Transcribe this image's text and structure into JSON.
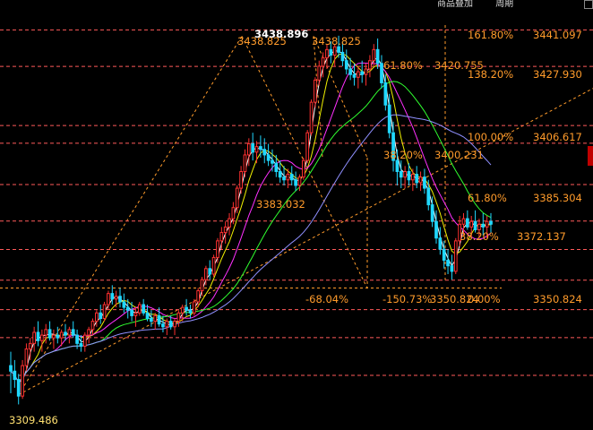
{
  "toolbar": {
    "items": [
      "商品叠加",
      "周期"
    ],
    "colors": {
      "text": "#d8d8d8"
    }
  },
  "chart_data": {
    "type": "candlestick",
    "title": "",
    "xlabel": "",
    "ylabel": "",
    "ylim": [
      3300,
      3448
    ],
    "grid": false,
    "colors": {
      "up": "#ff3030",
      "down": "#20d8ff",
      "fib_line": "#ff5a5a",
      "fib_text": "#ff9b2b",
      "helper": "#ff9b2b",
      "price_text": "#ffe070",
      "ma_white": "#ffffff",
      "ma_yellow": "#f0f000",
      "ma_magenta": "#ff30ff",
      "ma_green": "#30ff30",
      "ma_purple": "#9090ff"
    },
    "price_points": [
      {
        "name": "low-start",
        "price": 3309.486,
        "label": "3309.486"
      },
      {
        "name": "high-left",
        "price": 3438.825,
        "label": "3438.825"
      },
      {
        "name": "peak",
        "price": 3438.896,
        "label": "3438.896"
      },
      {
        "name": "high-right",
        "price": 3438.825,
        "label": "3438.825"
      },
      {
        "name": "mid-low",
        "price": 3383.032,
        "label": "3383.032"
      },
      {
        "name": "recent-low",
        "price": 3350.824,
        "label": "3350.824"
      }
    ],
    "fib_levels": [
      {
        "ratio": "161.80%",
        "price": 3441.097
      },
      {
        "ratio": "61.80%",
        "price": 3420.755
      },
      {
        "ratio": "138.20%",
        "price": 3427.93
      },
      {
        "ratio": "100.00%",
        "price": 3406.617
      },
      {
        "ratio": "38.20%",
        "price": 3400.231
      },
      {
        "ratio": "61.80%",
        "price": 3385.304
      },
      {
        "ratio": "38.20%",
        "price": 3372.137
      },
      {
        "ratio": "0.00%",
        "price": 3350.824
      }
    ],
    "fib_extra_labels": [
      "-68.04%",
      "-150.73%"
    ],
    "candles": [
      [
        3320,
        3325,
        3310,
        3318
      ],
      [
        3318,
        3322,
        3312,
        3315
      ],
      [
        3315,
        3317,
        3306,
        3309
      ],
      [
        3309,
        3322,
        3308,
        3320
      ],
      [
        3320,
        3328,
        3318,
        3326
      ],
      [
        3326,
        3330,
        3322,
        3328
      ],
      [
        3328,
        3334,
        3325,
        3332
      ],
      [
        3332,
        3336,
        3327,
        3329
      ],
      [
        3329,
        3333,
        3325,
        3331
      ],
      [
        3331,
        3335,
        3328,
        3333
      ],
      [
        3333,
        3336,
        3329,
        3330
      ],
      [
        3330,
        3333,
        3326,
        3331
      ],
      [
        3331,
        3334,
        3328,
        3330
      ],
      [
        3330,
        3333,
        3327,
        3332
      ],
      [
        3332,
        3335,
        3329,
        3331
      ],
      [
        3331,
        3334,
        3328,
        3333
      ],
      [
        3333,
        3336,
        3330,
        3331
      ],
      [
        3331,
        3333,
        3326,
        3328
      ],
      [
        3328,
        3331,
        3325,
        3327
      ],
      [
        3327,
        3332,
        3325,
        3331
      ],
      [
        3331,
        3334,
        3328,
        3333
      ],
      [
        3333,
        3337,
        3331,
        3336
      ],
      [
        3336,
        3340,
        3334,
        3339
      ],
      [
        3339,
        3342,
        3335,
        3337
      ],
      [
        3337,
        3343,
        3336,
        3342
      ],
      [
        3342,
        3347,
        3340,
        3346
      ],
      [
        3346,
        3349,
        3342,
        3344
      ],
      [
        3344,
        3347,
        3341,
        3345
      ],
      [
        3345,
        3348,
        3341,
        3343
      ],
      [
        3343,
        3346,
        3339,
        3341
      ],
      [
        3341,
        3344,
        3337,
        3340
      ],
      [
        3340,
        3343,
        3336,
        3338
      ],
      [
        3338,
        3341,
        3334,
        3339
      ],
      [
        3339,
        3343,
        3338,
        3342
      ],
      [
        3342,
        3344,
        3338,
        3339
      ],
      [
        3339,
        3342,
        3336,
        3337
      ],
      [
        3337,
        3340,
        3334,
        3336
      ],
      [
        3336,
        3339,
        3333,
        3338
      ],
      [
        3338,
        3341,
        3334,
        3335
      ],
      [
        3335,
        3338,
        3332,
        3334
      ],
      [
        3334,
        3337,
        3331,
        3336
      ],
      [
        3336,
        3338,
        3333,
        3334
      ],
      [
        3334,
        3337,
        3331,
        3336
      ],
      [
        3336,
        3340,
        3334,
        3339
      ],
      [
        3339,
        3342,
        3336,
        3341
      ],
      [
        3341,
        3344,
        3338,
        3340
      ],
      [
        3340,
        3342,
        3337,
        3339
      ],
      [
        3339,
        3344,
        3338,
        3343
      ],
      [
        3343,
        3348,
        3341,
        3347
      ],
      [
        3347,
        3352,
        3345,
        3351
      ],
      [
        3351,
        3356,
        3349,
        3355
      ],
      [
        3355,
        3358,
        3351,
        3353
      ],
      [
        3353,
        3360,
        3352,
        3359
      ],
      [
        3359,
        3366,
        3357,
        3365
      ],
      [
        3365,
        3370,
        3362,
        3368
      ],
      [
        3368,
        3372,
        3364,
        3370
      ],
      [
        3370,
        3375,
        3367,
        3373
      ],
      [
        3373,
        3379,
        3371,
        3377
      ],
      [
        3377,
        3385,
        3375,
        3384
      ],
      [
        3384,
        3392,
        3382,
        3390
      ],
      [
        3390,
        3398,
        3388,
        3396
      ],
      [
        3396,
        3402,
        3392,
        3400
      ],
      [
        3400,
        3404,
        3394,
        3397
      ],
      [
        3397,
        3401,
        3393,
        3399
      ],
      [
        3399,
        3403,
        3395,
        3398
      ],
      [
        3398,
        3402,
        3393,
        3396
      ],
      [
        3396,
        3400,
        3392,
        3394
      ],
      [
        3394,
        3398,
        3390,
        3393
      ],
      [
        3393,
        3396,
        3388,
        3390
      ],
      [
        3390,
        3394,
        3386,
        3388
      ],
      [
        3388,
        3392,
        3385,
        3387
      ],
      [
        3387,
        3391,
        3384,
        3389
      ],
      [
        3389,
        3392,
        3385,
        3387
      ],
      [
        3387,
        3390,
        3383,
        3385
      ],
      [
        3385,
        3389,
        3383,
        3388
      ],
      [
        3388,
        3395,
        3387,
        3394
      ],
      [
        3394,
        3405,
        3393,
        3404
      ],
      [
        3404,
        3416,
        3403,
        3415
      ],
      [
        3415,
        3424,
        3413,
        3423
      ],
      [
        3423,
        3430,
        3421,
        3428
      ],
      [
        3428,
        3433,
        3424,
        3431
      ],
      [
        3431,
        3436,
        3427,
        3434
      ],
      [
        3434,
        3437,
        3429,
        3432
      ],
      [
        3432,
        3436,
        3428,
        3435
      ],
      [
        3435,
        3439,
        3431,
        3433
      ],
      [
        3433,
        3437,
        3428,
        3430
      ],
      [
        3430,
        3434,
        3425,
        3427
      ],
      [
        3427,
        3431,
        3423,
        3425
      ],
      [
        3425,
        3429,
        3421,
        3424
      ],
      [
        3424,
        3428,
        3420,
        3426
      ],
      [
        3426,
        3430,
        3422,
        3425
      ],
      [
        3425,
        3429,
        3421,
        3427
      ],
      [
        3427,
        3432,
        3424,
        3430
      ],
      [
        3430,
        3436,
        3428,
        3434
      ],
      [
        3434,
        3438,
        3427,
        3429
      ],
      [
        3429,
        3432,
        3420,
        3422
      ],
      [
        3422,
        3425,
        3412,
        3414
      ],
      [
        3414,
        3418,
        3402,
        3404
      ],
      [
        3404,
        3408,
        3390,
        3394
      ],
      [
        3394,
        3398,
        3385,
        3390
      ],
      [
        3390,
        3394,
        3384,
        3388
      ],
      [
        3388,
        3392,
        3384,
        3390
      ],
      [
        3390,
        3393,
        3385,
        3387
      ],
      [
        3387,
        3391,
        3383,
        3389
      ],
      [
        3389,
        3392,
        3384,
        3386
      ],
      [
        3386,
        3390,
        3383,
        3388
      ],
      [
        3388,
        3391,
        3382,
        3384
      ],
      [
        3384,
        3387,
        3376,
        3378
      ],
      [
        3378,
        3381,
        3370,
        3372
      ],
      [
        3372,
        3376,
        3364,
        3366
      ],
      [
        3366,
        3370,
        3360,
        3362
      ],
      [
        3362,
        3365,
        3355,
        3358
      ],
      [
        3358,
        3362,
        3353,
        3356
      ],
      [
        3356,
        3360,
        3351,
        3354
      ],
      [
        3354,
        3366,
        3353,
        3365
      ],
      [
        3365,
        3374,
        3363,
        3371
      ],
      [
        3371,
        3375,
        3367,
        3373
      ],
      [
        3373,
        3376,
        3369,
        3370
      ],
      [
        3370,
        3374,
        3366,
        3372
      ],
      [
        3372,
        3376,
        3368,
        3369
      ],
      [
        3369,
        3373,
        3366,
        3371
      ],
      [
        3371,
        3375,
        3367,
        3370
      ],
      [
        3370,
        3374,
        3366,
        3372
      ],
      [
        3372,
        3375,
        3368,
        3371
      ]
    ]
  }
}
